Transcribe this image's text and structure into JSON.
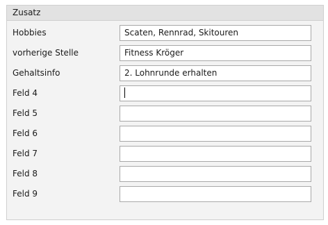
{
  "panel": {
    "title": "Zusatz"
  },
  "fields": [
    {
      "label": "Hobbies",
      "value": "Scaten, Rennrad, Skitouren"
    },
    {
      "label": "vorherige Stelle",
      "value": "Fitness Kröger"
    },
    {
      "label": "Gehaltsinfo",
      "value": "2. Lohnrunde erhalten"
    },
    {
      "label": "Feld 4",
      "value": ""
    },
    {
      "label": "Feld 5",
      "value": ""
    },
    {
      "label": "Feld 6",
      "value": ""
    },
    {
      "label": "Feld 7",
      "value": ""
    },
    {
      "label": "Feld 8",
      "value": ""
    },
    {
      "label": "Feld 9",
      "value": ""
    }
  ]
}
